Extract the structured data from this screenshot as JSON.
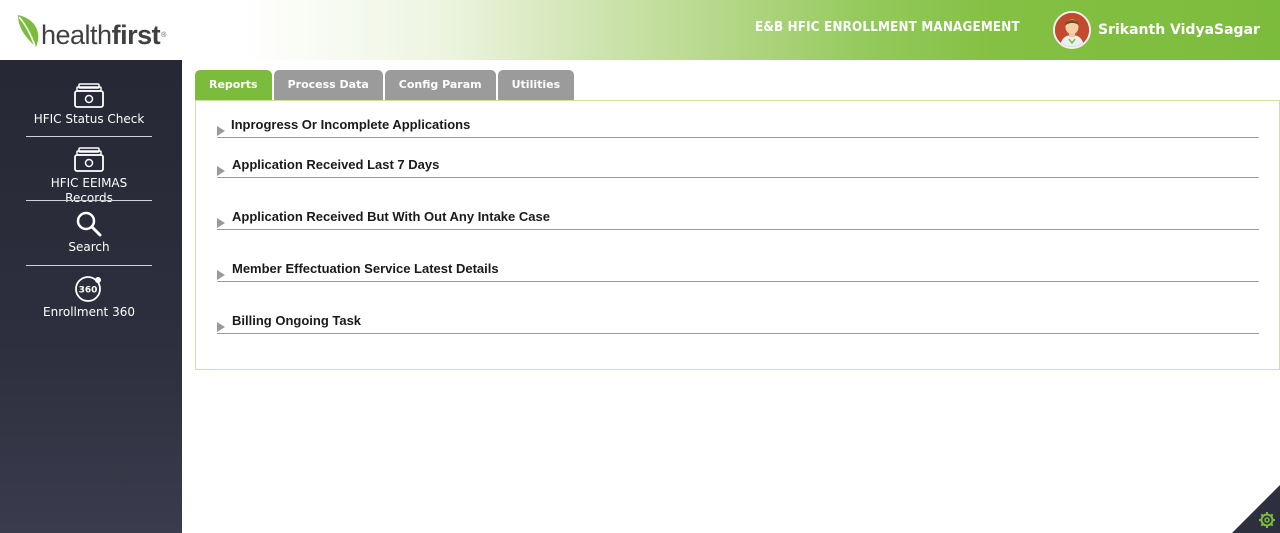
{
  "header": {
    "logo_text_light": "health",
    "logo_text_bold": "first",
    "logo_tm": "®",
    "app_title": "E&B HFIC ENROLLMENT MANAGEMENT",
    "user_name": "Srikanth VidyaSagar"
  },
  "sidebar": {
    "items": [
      {
        "label": "HFIC Status Check",
        "icon": "files-icon"
      },
      {
        "label": "HFIC EEIMAS Records",
        "icon": "files-icon"
      },
      {
        "label": "Search",
        "icon": "search-icon"
      },
      {
        "label": "Enrollment 360",
        "icon": "enrollment-360-icon",
        "icon_text": "360"
      }
    ]
  },
  "tabs": [
    {
      "label": "Reports",
      "active": true
    },
    {
      "label": "Process Data",
      "active": false
    },
    {
      "label": "Config Param",
      "active": false
    },
    {
      "label": "Utilities",
      "active": false
    }
  ],
  "reports": [
    {
      "label": "Inprogress Or Incomplete Applications"
    },
    {
      "label": "Application Received Last 7 Days"
    },
    {
      "label": "Application Received But With Out Any Intake Case"
    },
    {
      "label": "Member Effectuation Service Latest Details"
    },
    {
      "label": "Billing Ongoing Task"
    }
  ],
  "colors": {
    "brand_green": "#7cbc3c",
    "sidebar_bg": "#2d2f3e",
    "tab_inactive": "#9b9b9b"
  }
}
